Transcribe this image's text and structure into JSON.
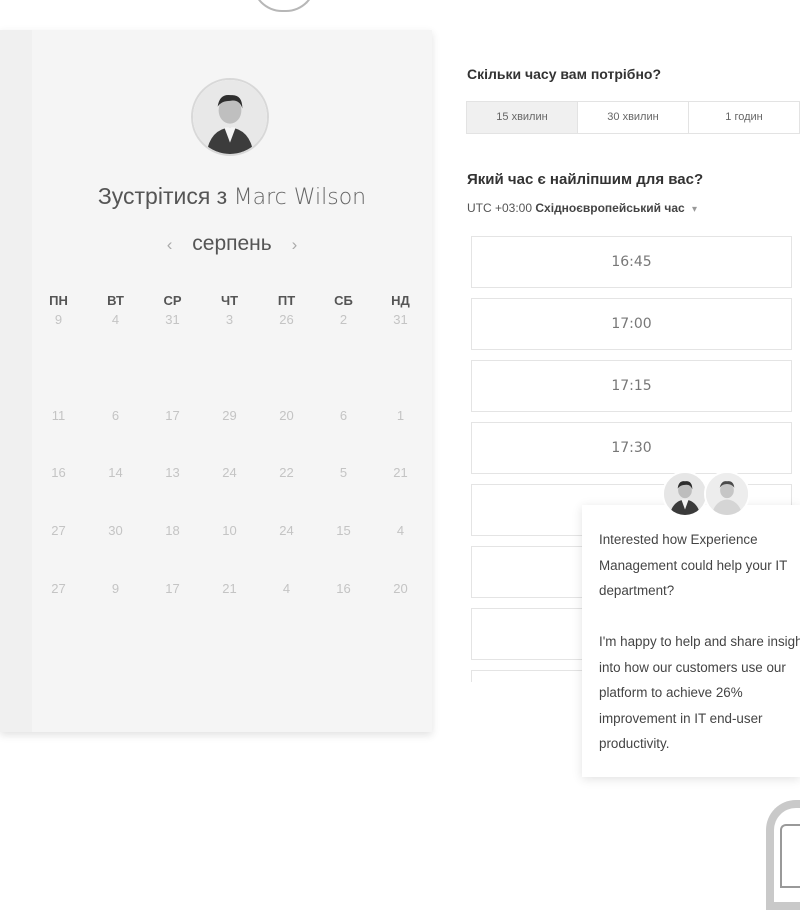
{
  "calendar": {
    "title_prefix": "Зустрітися з",
    "host_name": "Marc Wilson",
    "month": "серпень",
    "prev_arrow": "‹",
    "next_arrow": "›",
    "weekdays": [
      "ПН",
      "ВТ",
      "СР",
      "ЧТ",
      "ПТ",
      "СБ",
      "НД"
    ],
    "rows": [
      [
        "9",
        "4",
        "31",
        "3",
        "26",
        "2",
        "31"
      ],
      [
        "11",
        "6",
        "17",
        "29",
        "20",
        "6",
        "1"
      ],
      [
        "16",
        "14",
        "13",
        "24",
        "22",
        "5",
        "21"
      ],
      [
        "27",
        "30",
        "18",
        "10",
        "24",
        "15",
        "4"
      ],
      [
        "27",
        "9",
        "17",
        "21",
        "4",
        "16",
        "20"
      ]
    ]
  },
  "duration": {
    "heading": "Скільки часу вам потрібно?",
    "options": [
      "15 хвилин",
      "30 хвилин",
      "1 годин"
    ],
    "selected_index": 0
  },
  "time": {
    "heading": "Який час є найліпшим для вас?",
    "tz_offset": "UTC +03:00",
    "tz_name": "Східноєвропейський час",
    "tz_caret": "▾",
    "slots": [
      "16:45",
      "17:00",
      "17:15",
      "17:30",
      "",
      "",
      "",
      ""
    ]
  },
  "chat": {
    "message": "Interested how Experience Management could help your IT department?\n\nI'm happy to help and share insight into how our customers use our platform to achieve 26% improvement in IT end-user productivity."
  },
  "icons": {
    "host_avatar": "person-avatar-icon",
    "chat_avatar_1": "person-avatar-icon",
    "chat_avatar_2": "person-avatar-icon",
    "chat_launcher": "chat-bubble-icon"
  }
}
